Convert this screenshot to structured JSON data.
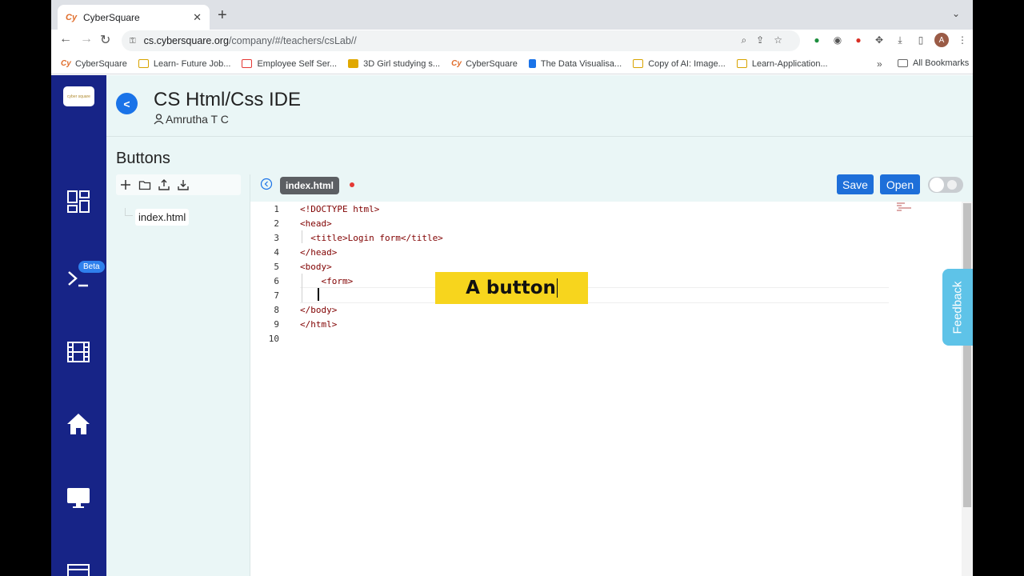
{
  "browser": {
    "tab_title": "CyberSquare",
    "tab_favicon": "Cy",
    "url_host": "cs.cybersquare.org",
    "url_path": "/company/#/teachers/csLab//",
    "profile_initial": "A"
  },
  "bookmarks": [
    {
      "label": "CyberSquare",
      "icon": "cy"
    },
    {
      "label": "Learn- Future Job...",
      "icon": "folder"
    },
    {
      "label": "Employee Self Ser...",
      "icon": "form"
    },
    {
      "label": "3D Girl studying s...",
      "icon": "img"
    },
    {
      "label": "CyberSquare",
      "icon": "cy"
    },
    {
      "label": "The Data Visualisa...",
      "icon": "chart"
    },
    {
      "label": "Copy of AI: Image...",
      "icon": "folder"
    },
    {
      "label": "Learn-Application...",
      "icon": "folder"
    }
  ],
  "bookmarks_more": "»",
  "bookmarks_all": "All Bookmarks",
  "sidebar": {
    "logo_text": "cyber square",
    "beta_label": "Beta"
  },
  "header": {
    "title": "CS Html/Css IDE",
    "author": "Amrutha T C"
  },
  "project": {
    "name": "Buttons",
    "files": [
      "index.html"
    ]
  },
  "editor": {
    "active_tab": "index.html",
    "save_label": "Save",
    "open_label": "Open",
    "lines": [
      {
        "n": "1",
        "text": "<!DOCTYPE html>"
      },
      {
        "n": "2",
        "text": "<head>"
      },
      {
        "n": "3",
        "text": "  <title>Login form</title>"
      },
      {
        "n": "4",
        "text": "</head>"
      },
      {
        "n": "5",
        "text": "<body>"
      },
      {
        "n": "6",
        "text": "    <form>"
      },
      {
        "n": "7",
        "text": ""
      },
      {
        "n": "8",
        "text": "</body>"
      },
      {
        "n": "9",
        "text": "</html>"
      },
      {
        "n": "10",
        "text": ""
      }
    ]
  },
  "overlay_caption": "A button",
  "feedback_label": "Feedback",
  "colors": {
    "sidebar": "#172487",
    "app_bg": "#eaf6f6",
    "accent": "#1e6fd9",
    "caption_bg": "#f7d51d",
    "feedback": "#5ec3e8"
  }
}
